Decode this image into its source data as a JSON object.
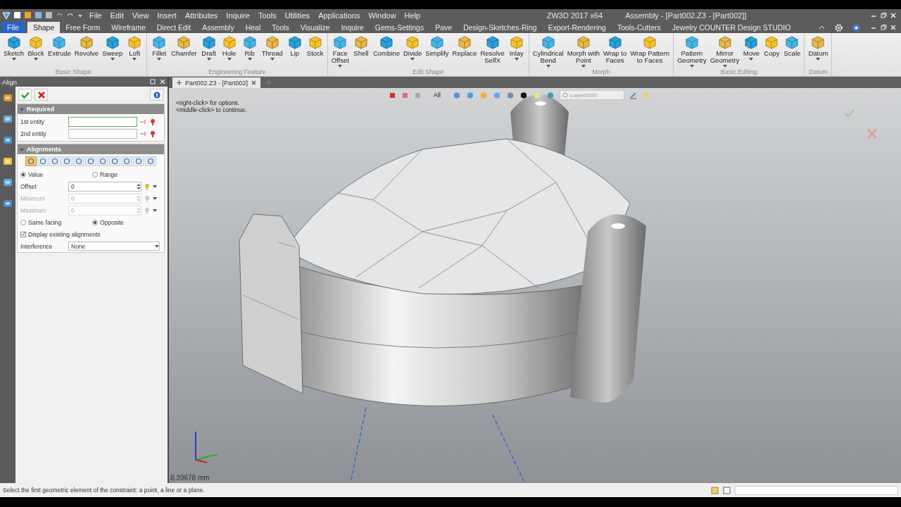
{
  "menu_bar": {
    "items": [
      "File",
      "Edit",
      "View",
      "Insert",
      "Attributes",
      "Inquire",
      "Tools",
      "Utilities",
      "Applications",
      "Window",
      "Help"
    ],
    "app_title": "ZW3D 2017  x64",
    "document_title": "Assembly - [Part002.Z3 - [Part002]]"
  },
  "ribbon_tabs": [
    {
      "label": "File",
      "kind": "file",
      "selected": false
    },
    {
      "label": "Shape",
      "kind": "tab",
      "selected": true
    },
    {
      "label": "Free Form",
      "kind": "tab",
      "selected": false
    },
    {
      "label": "Wireframe",
      "kind": "tab",
      "selected": false
    },
    {
      "label": "Direct Edit",
      "kind": "tab",
      "selected": false
    },
    {
      "label": "Assembly",
      "kind": "tab",
      "selected": false
    },
    {
      "label": "Heal",
      "kind": "tab",
      "selected": false
    },
    {
      "label": "Tools",
      "kind": "tab",
      "selected": false
    },
    {
      "label": "Visualize",
      "kind": "tab",
      "selected": false
    },
    {
      "label": "Inquire",
      "kind": "tab",
      "selected": false
    },
    {
      "label": "Gems-Settings",
      "kind": "tab",
      "selected": false
    },
    {
      "label": "Pave",
      "kind": "tab",
      "selected": false
    },
    {
      "label": "Design-Sketches-Ring",
      "kind": "tab",
      "selected": false
    },
    {
      "label": "Export-Rendering",
      "kind": "tab",
      "selected": false
    },
    {
      "label": "Tools-Cutters",
      "kind": "tab",
      "selected": false
    },
    {
      "label": "Jewelry COUNTER Design STUDIO",
      "kind": "tab",
      "selected": false
    }
  ],
  "ribbon_groups": [
    {
      "label": "Basic Shape",
      "tools": [
        {
          "label": "Sketch",
          "dropdown": true
        },
        {
          "label": "Block",
          "dropdown": true
        },
        {
          "label": "Extrude",
          "dropdown": false
        },
        {
          "label": "Revolve",
          "dropdown": false
        },
        {
          "label": "Sweep",
          "dropdown": true
        },
        {
          "label": "Loft",
          "dropdown": true
        }
      ]
    },
    {
      "label": "Engineering Feature",
      "tools": [
        {
          "label": "Fillet",
          "dropdown": true
        },
        {
          "label": "Chamfer",
          "dropdown": false
        },
        {
          "label": "Draft",
          "dropdown": true
        },
        {
          "label": "Hole",
          "dropdown": true
        },
        {
          "label": "Rib",
          "dropdown": true
        },
        {
          "label": "Thread",
          "dropdown": true
        },
        {
          "label": "Lip",
          "dropdown": false
        },
        {
          "label": "Stock",
          "dropdown": false
        }
      ]
    },
    {
      "label": "Edit Shape",
      "tools": [
        {
          "label": "Face\nOffset",
          "dropdown": true
        },
        {
          "label": "Shell",
          "dropdown": false
        },
        {
          "label": "Combine",
          "dropdown": false
        },
        {
          "label": "Divide",
          "dropdown": true
        },
        {
          "label": "Simplify",
          "dropdown": false
        },
        {
          "label": "Replace",
          "dropdown": false
        },
        {
          "label": "Resolve\nSelfX",
          "dropdown": false
        },
        {
          "label": "Inlay",
          "dropdown": true
        }
      ]
    },
    {
      "label": "Morph",
      "tools": [
        {
          "label": "Cylindrical\nBend",
          "dropdown": true
        },
        {
          "label": "Morph with\nPoint",
          "dropdown": true
        },
        {
          "label": "Wrap to\nFaces",
          "dropdown": false
        },
        {
          "label": "Wrap Pattern\nto Faces",
          "dropdown": false
        }
      ]
    },
    {
      "label": "Basic Editing",
      "tools": [
        {
          "label": "Pattern\nGeometry",
          "dropdown": true
        },
        {
          "label": "Mirror\nGeometry",
          "dropdown": true
        },
        {
          "label": "Move",
          "dropdown": true
        },
        {
          "label": "Copy",
          "dropdown": false
        },
        {
          "label": "Scale",
          "dropdown": false
        }
      ]
    },
    {
      "label": "Datum",
      "tools": [
        {
          "label": "Datum",
          "dropdown": true
        }
      ]
    }
  ],
  "panel": {
    "title": "Align",
    "required": {
      "title": "Required",
      "fields": [
        {
          "label": "1st entity",
          "active": true
        },
        {
          "label": "2nd entity",
          "active": false
        }
      ]
    },
    "alignments": {
      "title": "Alignments",
      "types": [
        {
          "selected": true
        },
        {
          "selected": false
        },
        {
          "selected": false
        },
        {
          "selected": false
        },
        {
          "selected": false
        },
        {
          "selected": false
        },
        {
          "selected": false
        },
        {
          "selected": false
        },
        {
          "selected": false
        },
        {
          "selected": false
        },
        {
          "selected": false
        }
      ],
      "mode": [
        {
          "label": "Value",
          "selected": true
        },
        {
          "label": "Range",
          "selected": false
        }
      ],
      "values": [
        {
          "label": "Offset",
          "value": "0",
          "disabled": false
        },
        {
          "label": "Minimum",
          "value": "0",
          "disabled": true
        },
        {
          "label": "Maximum",
          "value": "0",
          "disabled": true
        }
      ],
      "facing": [
        {
          "label": "Same facing",
          "selected": false
        },
        {
          "label": "Opposite",
          "selected": true
        }
      ],
      "display_existing": {
        "label": "Display existing alignments",
        "checked": true
      },
      "interference": {
        "label": "Interference",
        "value": "None"
      }
    }
  },
  "viewport": {
    "tab": "Part002.Z3 - [Part002]",
    "hints": [
      "<right-click> for options.",
      "<middle-click> to continue."
    ],
    "filter": "All",
    "layer": "Layer0000",
    "scale": "8.39678 mm"
  },
  "status_bar": {
    "message": "Select the first geometric element of the constraint: a point, a line or a plane."
  }
}
